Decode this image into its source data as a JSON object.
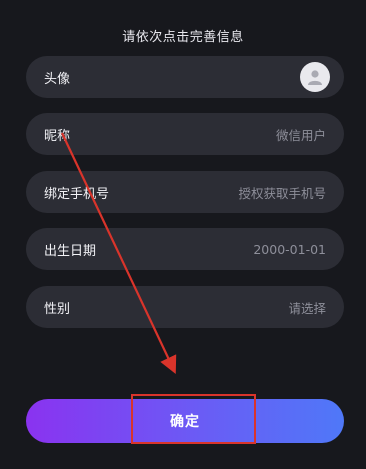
{
  "header": {
    "title": "请依次点击完善信息"
  },
  "form": {
    "rows": [
      {
        "label": "头像",
        "value": ""
      },
      {
        "label": "昵称",
        "value": "微信用户"
      },
      {
        "label": "绑定手机号",
        "value": "授权获取手机号"
      },
      {
        "label": "出生日期",
        "value": "2000-01-01"
      },
      {
        "label": "性别",
        "value": "请选择"
      }
    ]
  },
  "confirm": {
    "label": "确定"
  },
  "colors": {
    "background": "#17181d",
    "row_background": "#2c2d35",
    "button_gradient_start": "#8a33f0",
    "button_gradient_end": "#4f78f8",
    "annotation_red": "#d9342b"
  },
  "icons": {
    "avatar": "user-placeholder-icon"
  }
}
